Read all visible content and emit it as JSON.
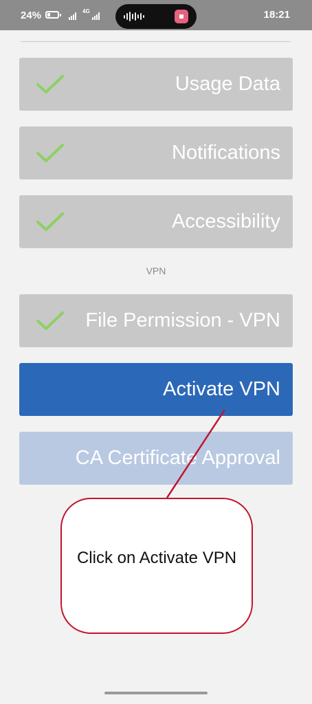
{
  "status_bar": {
    "battery_percent": "24%",
    "network": "4G",
    "time": "18:21",
    "icons": [
      "battery-icon",
      "signal-icon",
      "audio-wave-icon",
      "app-icon"
    ]
  },
  "permissions": {
    "items": [
      {
        "label": "Usage Data",
        "checked": true
      },
      {
        "label": "Notifications",
        "checked": true
      },
      {
        "label": "Accessibility",
        "checked": true
      }
    ],
    "vpn_section_label": "VPN",
    "vpn_items": [
      {
        "label": "File Permission - VPN",
        "checked": true
      }
    ],
    "activate_vpn_label": "Activate VPN",
    "ca_certificate_label": "CA Certificate Approval"
  },
  "annotation": {
    "text": "Click on Activate VPN"
  },
  "colors": {
    "checkmark": "#8ed063",
    "button_gray": "#c8c8c8",
    "activate_blue": "#2c68b8",
    "ca_light_blue": "#b9c9e2",
    "callout_red": "#c0152c"
  }
}
